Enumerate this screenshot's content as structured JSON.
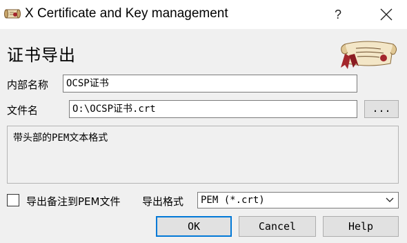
{
  "window": {
    "title": "X Certificate and Key management",
    "help_glyph": "?",
    "icons": {
      "app": "scroll-icon",
      "close": "close-icon"
    }
  },
  "dialog": {
    "heading": "证书导出",
    "logo_icon": "certificate-scroll-logo",
    "internal_name_label": "内部名称",
    "internal_name_value": "OCSP证书",
    "filename_label": "文件名",
    "filename_value": "O:\\OCSP证书.crt",
    "browse_label": "...",
    "description": "带头部的PEM文本格式",
    "export_comment_label": "导出备注到PEM文件",
    "export_comment_checked": false,
    "export_format_label": "导出格式",
    "export_format_value": "PEM (*.crt)"
  },
  "buttons": {
    "ok": "OK",
    "cancel": "Cancel",
    "help": "Help"
  },
  "colors": {
    "window_bg": "#f0f0f0",
    "titlebar_bg": "#ffffff",
    "default_button_border": "#0078d7",
    "logo_accent": "#a3262c"
  }
}
